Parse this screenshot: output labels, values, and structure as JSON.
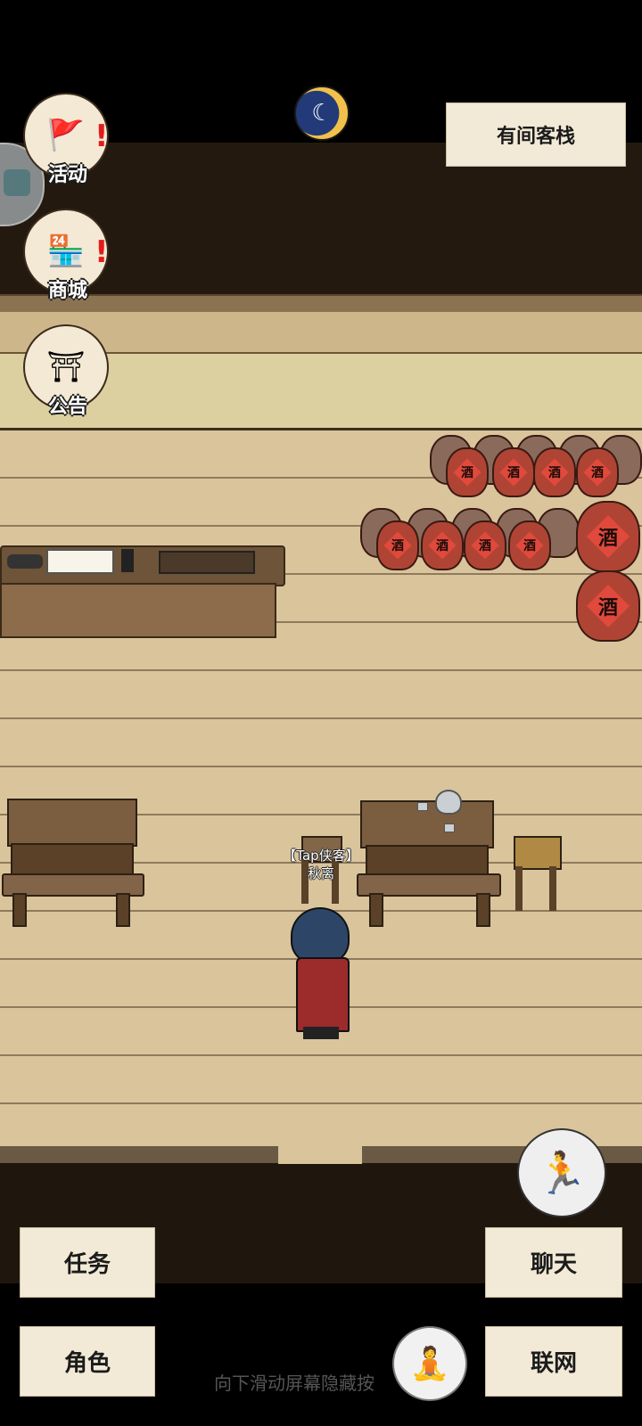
{
  "header": {
    "location_label": "有间客栈",
    "moon_icon": "day-night-indicator-icon"
  },
  "left_menu": {
    "items": [
      {
        "label": "活动",
        "icon": "activity-banner-icon",
        "alert": "!"
      },
      {
        "label": "商城",
        "icon": "shop-stall-icon",
        "alert": "!"
      },
      {
        "label": "公告",
        "icon": "notice-board-icon"
      }
    ]
  },
  "scene": {
    "jar_text": "酒",
    "player": {
      "title": "【Tap侠客】",
      "name": "秋离"
    }
  },
  "bottom_bar": {
    "task_label": "任务",
    "role_label": "角色",
    "chat_label": "聊天",
    "online_label": "联网",
    "hint": "向下滑动屏幕隐藏按",
    "sprint_icon": "running-man-icon",
    "meditate_icon": "meditation-icon"
  },
  "colors": {
    "paper": "#f2ead6",
    "floor": "#d9c49c",
    "wall_dark": "#24190f",
    "alert": "#e31b1b"
  }
}
